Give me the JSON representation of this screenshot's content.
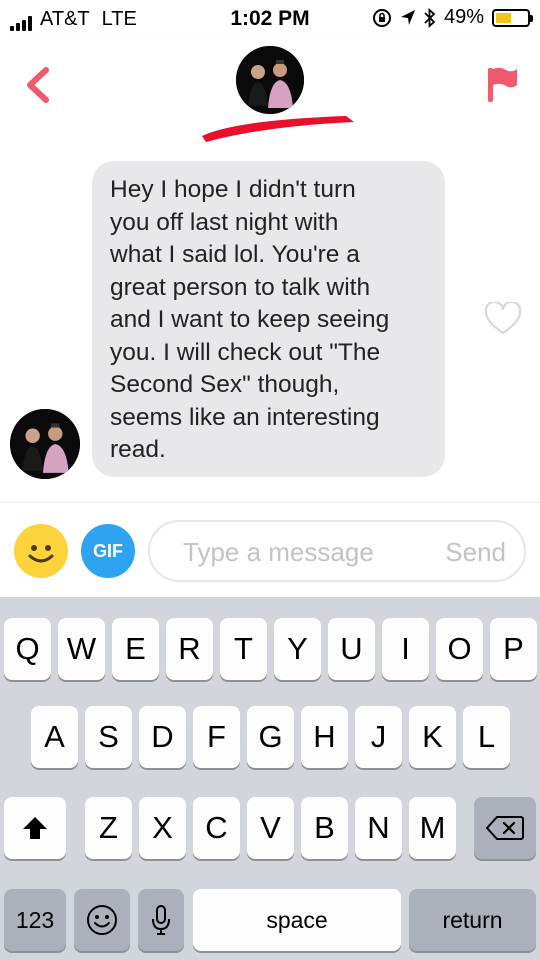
{
  "status_bar": {
    "carrier": "AT&T",
    "network": "LTE",
    "time": "1:02 PM",
    "battery_percent": "49%",
    "battery_level": 0.49,
    "icons": [
      "signal-icon",
      "lock-rotation-icon",
      "location-icon",
      "bluetooth-icon",
      "battery-icon"
    ]
  },
  "header": {
    "icons": [
      "back-chevron-icon",
      "avatar",
      "flag-icon"
    ],
    "accent_color": "#f05a6e",
    "redaction_color": "#e8112d"
  },
  "chat": {
    "message": {
      "text": "Hey I hope I didn't turn you off last night with what I said lol. You're a great person to talk with and I want to keep seeing you. I will check out \"The Second Sex\" though, seems like an interesting read.",
      "lines": [
        "Hey I hope I didn't turn",
        "you off last night with",
        "what I said lol. You're a",
        "great person to talk with",
        "and I want to keep seeing",
        "you. I will check out \"The",
        "Second Sex\" though,",
        "seems like an interesting",
        "read."
      ],
      "bubble_color": "#e8e8ec"
    },
    "icons": [
      "avatar",
      "heart-icon"
    ]
  },
  "compose": {
    "gif_label": "GIF",
    "placeholder": "Type a message",
    "send_label": "Send",
    "emoji_color": "#fcd33a",
    "gif_color": "#2ea3f2"
  },
  "keyboard": {
    "row1": [
      "Q",
      "W",
      "E",
      "R",
      "T",
      "Y",
      "U",
      "I",
      "O",
      "P"
    ],
    "row2": [
      "A",
      "S",
      "D",
      "F",
      "G",
      "H",
      "J",
      "K",
      "L"
    ],
    "row3": [
      "Z",
      "X",
      "C",
      "V",
      "B",
      "N",
      "M"
    ],
    "numbers_label": "123",
    "space_label": "space",
    "return_label": "return",
    "icons": [
      "shift-icon",
      "backspace-icon",
      "emoji-keyboard-icon",
      "microphone-icon"
    ]
  }
}
